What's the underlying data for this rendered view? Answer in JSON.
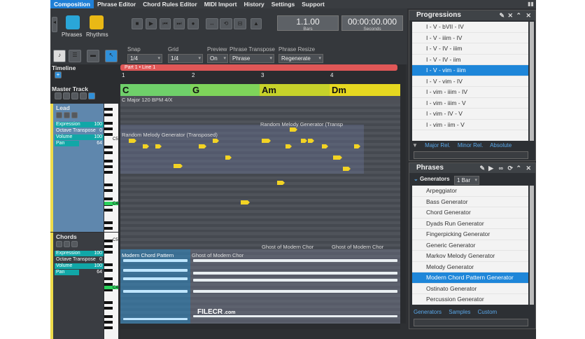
{
  "menu": {
    "items": [
      "Composition",
      "Phrase Editor",
      "Chord Rules Editor",
      "MIDI Import",
      "History",
      "Settings",
      "Support"
    ],
    "active": "Composition"
  },
  "toolbar": {
    "phrases_label": "Phrases",
    "rhythms_label": "Rhythms",
    "bars_value": "1.1.00",
    "bars_label": "Bars",
    "seconds_value": "00:00:00.000",
    "seconds_label": "Seconds"
  },
  "options": {
    "snap_label": "Snap",
    "snap_value": "1/4",
    "grid_label": "Grid",
    "grid_value": "1/4",
    "preview_label": "Preview",
    "preview_value": "On",
    "transpose_label": "Phrase Transpose",
    "transpose_value": "Phrase",
    "resize_label": "Phrase Resize",
    "resize_value": "Regenerate"
  },
  "timeline": {
    "label": "Timeline",
    "part_label": "Part 1 • Line 1",
    "bars": [
      "1",
      "2",
      "3",
      "4"
    ],
    "chords": [
      "C",
      "G",
      "Am",
      "Dm"
    ],
    "chord_colors": [
      "#6fd06a",
      "#7ed45a",
      "#c6d22a",
      "#e6d820"
    ],
    "info": "C Major  120 BPM  4/X"
  },
  "master_track": {
    "label": "Master Track"
  },
  "tracks": [
    {
      "name": "Lead",
      "params": [
        {
          "name": "Expression",
          "value": "100",
          "fill": 1.0
        },
        {
          "name": "Octave Transpose",
          "value": "0",
          "fill": 0.0
        },
        {
          "name": "Volume",
          "value": "100",
          "fill": 1.0
        },
        {
          "name": "Pan",
          "value": "64",
          "fill": 0.5
        }
      ],
      "segments": [
        "Random Melody Generator (Transposed)",
        "Random Melody Generator (Transp"
      ]
    },
    {
      "name": "Chords",
      "params": [
        {
          "name": "Expression",
          "value": "100",
          "fill": 1.0
        },
        {
          "name": "Octave Transpose",
          "value": "0",
          "fill": 0.0
        },
        {
          "name": "Volume",
          "value": "100",
          "fill": 1.0
        },
        {
          "name": "Pan",
          "value": "64",
          "fill": 0.5
        }
      ],
      "segments": [
        "Modern Chord Pattern",
        "Ghost of Modern Chor",
        "Ghost of Modern Chor",
        "Ghost of Modern Chor"
      ]
    }
  ],
  "piano_labels": {
    "c5": "C5",
    "c4": "C4",
    "c5b": "C5",
    "c4b": "C4"
  },
  "progressions": {
    "title": "Progressions",
    "items": [
      "I - V - bVII - IV",
      "I - V - iiim - IV",
      "I - V - IV - iiim",
      "I - V - IV - iim",
      "I - V - vim - iiim",
      "I - V - vim - IV",
      "I - vim - iiim - IV",
      "I - vim - iiim - V",
      "I - vim - IV - V",
      "I - vim - iim - V"
    ],
    "selected_index": 4,
    "tabs": [
      "Major Rel.",
      "Minor Rel.",
      "Absolute"
    ]
  },
  "phrases": {
    "title": "Phrases",
    "category": "Generators",
    "length": "1 Bar",
    "items": [
      "Arpeggiator",
      "Bass Generator",
      "Chord Generator",
      "Dyads Run Generator",
      "Fingerpicking Generator",
      "Generic Generator",
      "Markov Melody Generator",
      "Melody Generator",
      "Modern Chord Pattern Generator",
      "Ostinato Generator",
      "Percussion Generator"
    ],
    "selected_index": 8,
    "tabs": [
      "Generators",
      "Samples",
      "Custom"
    ]
  },
  "watermark": "FILECR",
  "watermark_sub": ".com"
}
